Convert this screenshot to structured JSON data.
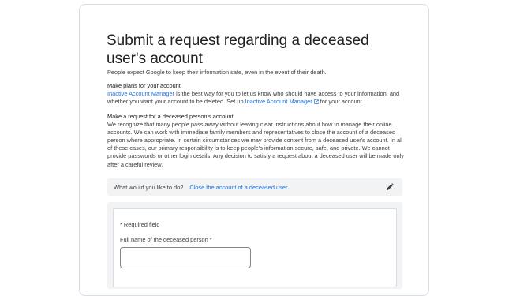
{
  "page": {
    "title": "Submit a request regarding a deceased user's account",
    "intro": "People expect Google to keep their information safe, even in the event of their death."
  },
  "plans": {
    "heading": "Make plans for your account",
    "link1": "Inactive Account Manager",
    "text1": " is the best way for you to let us know who should have access to your information, and whether you want your account to be deleted. Set up ",
    "link2": "Inactive Account Manager",
    "text2": " for your account."
  },
  "request": {
    "heading": "Make a request for a deceased person's account",
    "body": "We recognize that many people pass away without leaving clear instructions about how to manage their online accounts. We can work with immediate family members and representatives to close the account of a deceased person where appropriate. In certain circumstances we may provide content from a deceased user's account. In all of these cases, our primary responsibility is to keep people's information secure, safe, and private. We cannot provide passwords or other login details. Any decision to satisfy a request about a deceased user will be made only after a careful review."
  },
  "choice": {
    "label": "What would you like to do?",
    "value": "Close the account of a deceased user",
    "edit_icon": "pencil-icon"
  },
  "form": {
    "required_note": "* Required field",
    "name_label": "Full name of the deceased person *",
    "name_value": ""
  },
  "colors": {
    "link": "#1a73e8",
    "text": "#3c4043",
    "heading": "#202124",
    "panel": "#f1f3f4"
  }
}
